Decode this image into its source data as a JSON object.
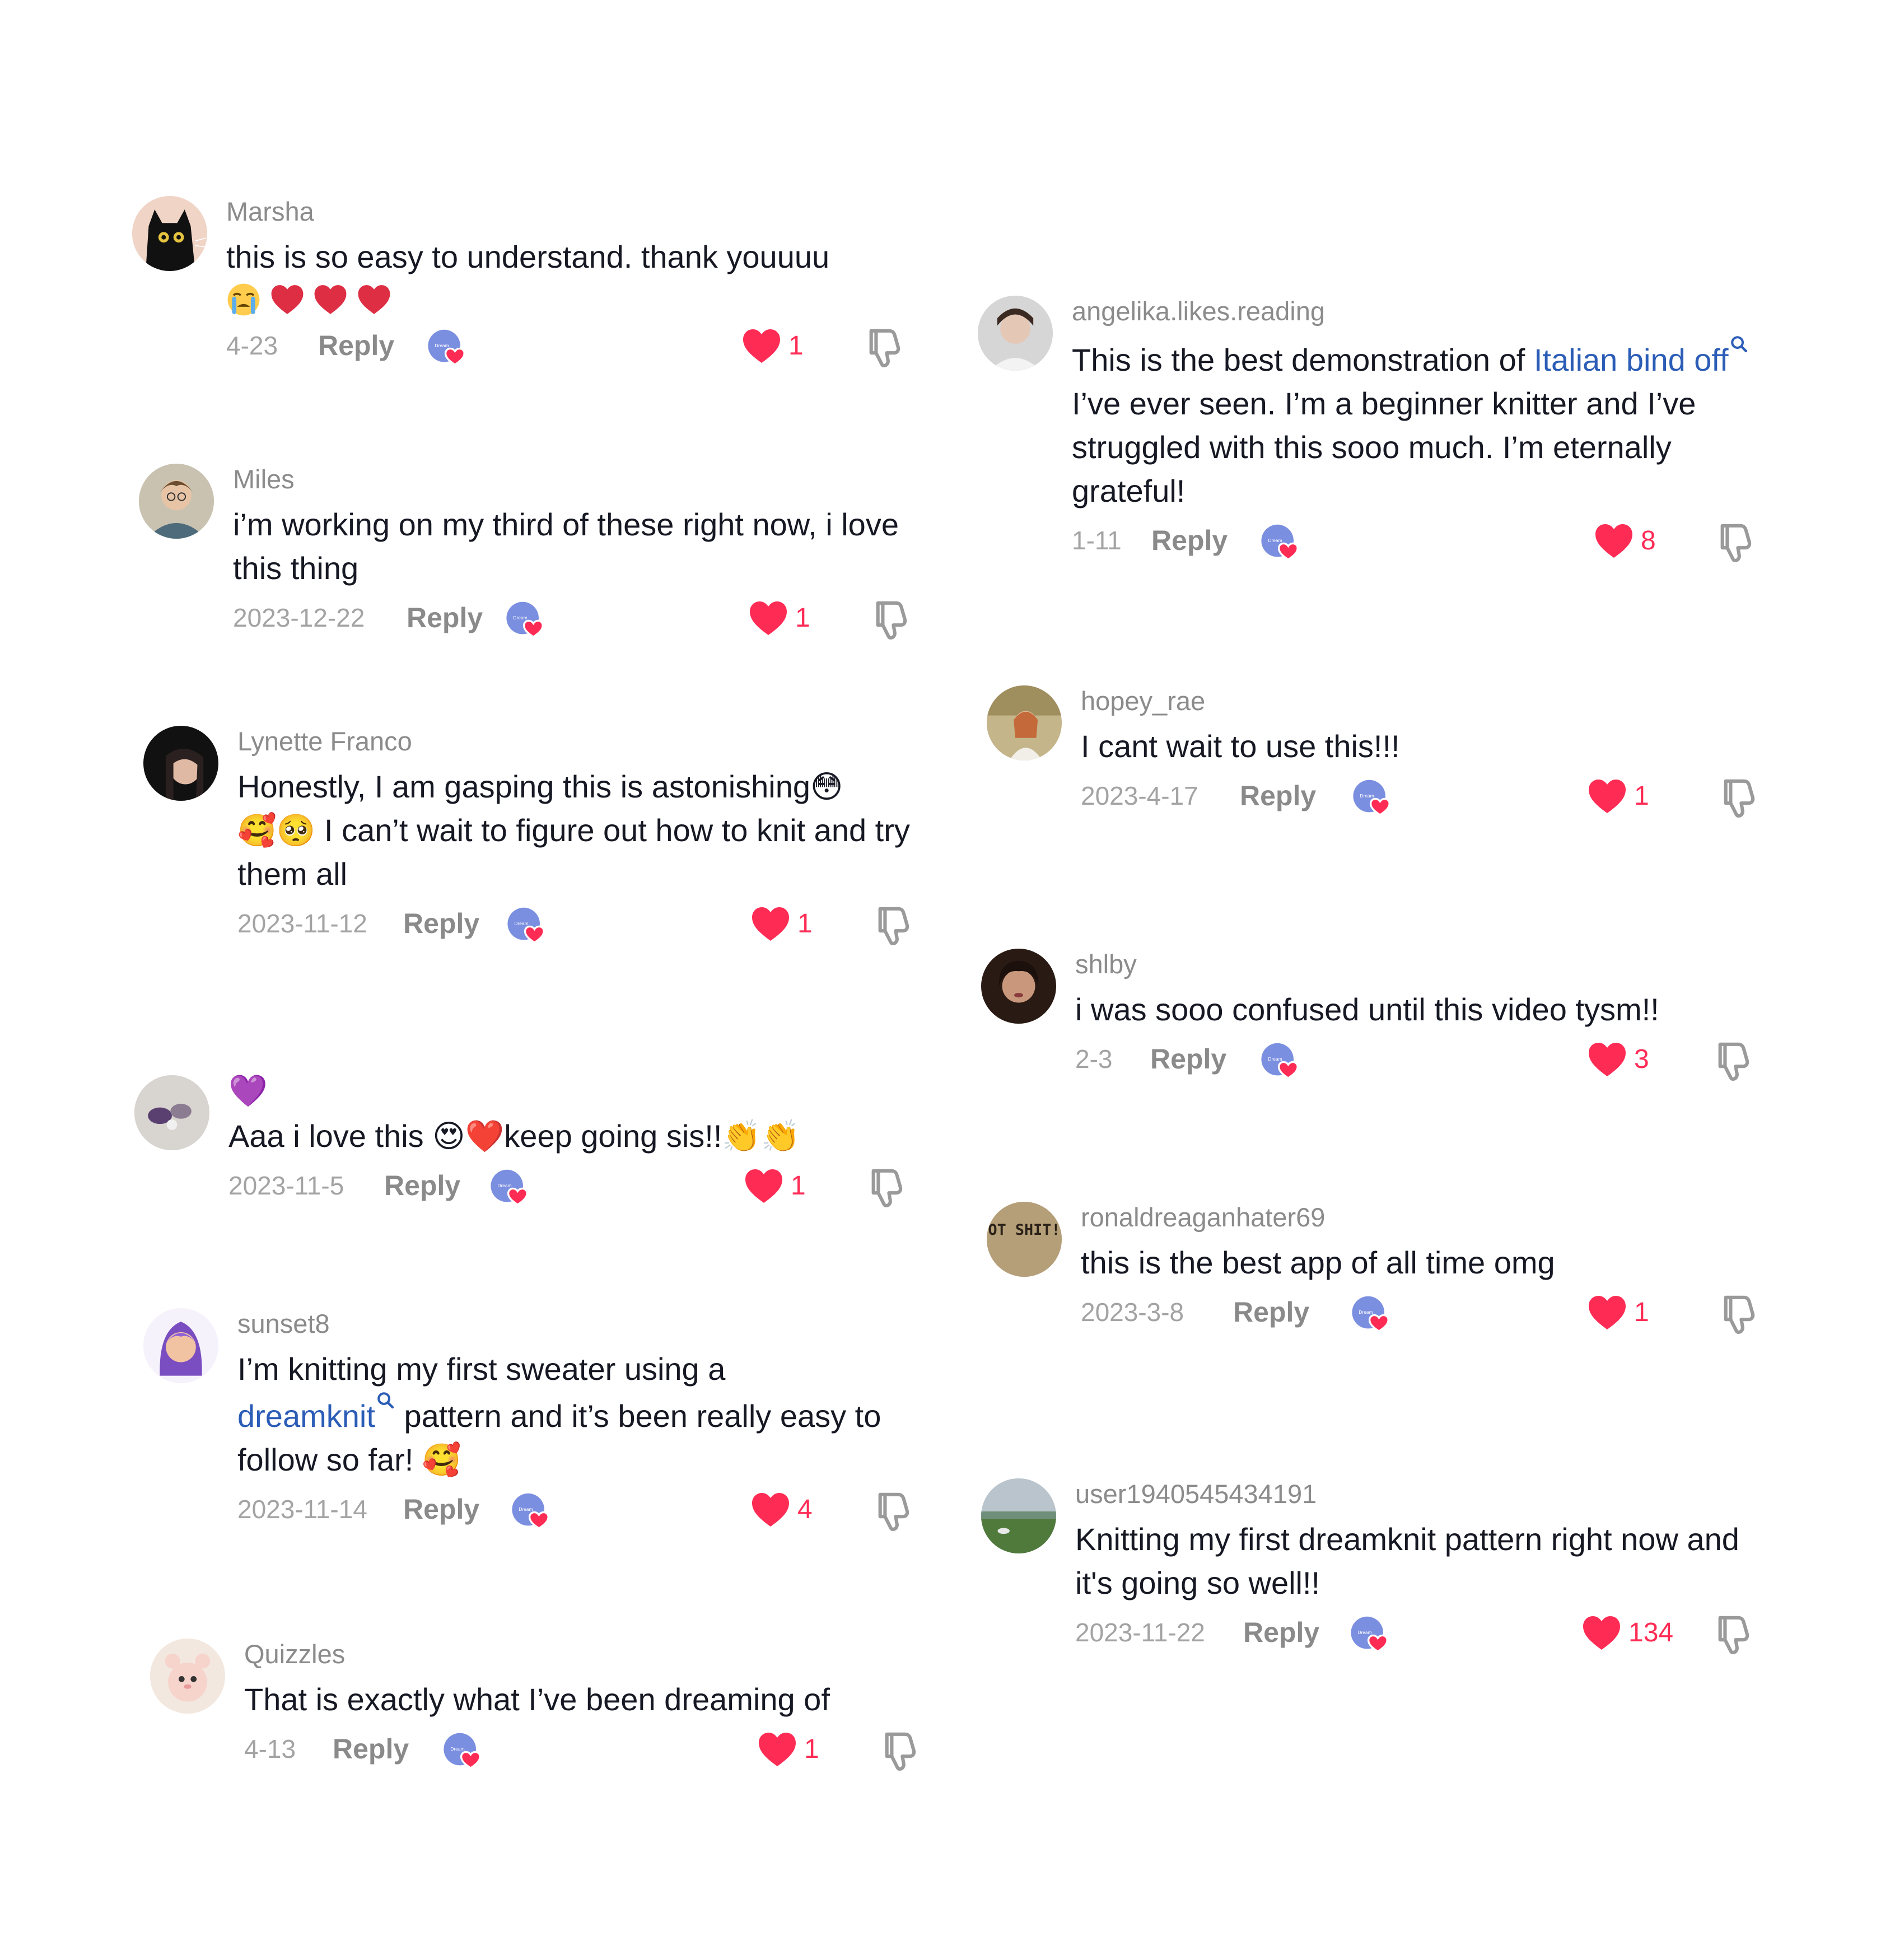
{
  "ui": {
    "reply_label": "Reply"
  },
  "colors": {
    "like": "#fe2c55",
    "link": "#2b5db7",
    "username": "#8b8b8b",
    "meta": "#a3a3a3"
  },
  "left_column": [
    {
      "username": "Marsha",
      "text": "this is so easy to understand. thank youuuu",
      "emoji_line": "😭❤️❤️❤️",
      "date": "4-23",
      "likes": "1"
    },
    {
      "username": "Miles",
      "text": "i’m working on my third of these right now, i love this thing",
      "date": "2023-12-22",
      "likes": "1"
    },
    {
      "username": "Lynette Franco",
      "text_a": "Honestly, I am gasping this is astonishing😳",
      "text_b": "🥰🥺 I can’t wait to figure out how to knit and try them all",
      "date": "2023-11-12",
      "likes": "1"
    },
    {
      "username": "💜",
      "text": "Aaa i love this 😍❤️keep going sis!!👏👏",
      "date": "2023-11-5",
      "likes": "1"
    },
    {
      "username": "sunset8",
      "text_a": "I’m knitting my first sweater using a",
      "link": "dreamknit",
      "text_b": "pattern and it’s been really easy to follow so far! 🥰",
      "date": "2023-11-14",
      "likes": "4"
    },
    {
      "username": "Quizzles",
      "text": "That is exactly what I’ve been dreaming of",
      "date": "4-13",
      "likes": "1"
    }
  ],
  "right_column": [
    {
      "username": "angelika.likes.reading",
      "text_a": "This is the best demonstration of",
      "link": "Italian bind off",
      "text_b": "I’ve ever seen. I’m a beginner knitter and I’ve struggled with this sooo much. I’m eternally grateful!",
      "date": "1-11",
      "likes": "8"
    },
    {
      "username": "hopey_rae",
      "text": "I cant wait to use this!!!",
      "date": "2023-4-17",
      "likes": "1"
    },
    {
      "username": "shlby",
      "text": "i was sooo confused until this video tysm!!",
      "date": "2-3",
      "likes": "3"
    },
    {
      "username": "ronaldreaganhater69",
      "text": "this is the best app of all time omg",
      "date": "2023-3-8",
      "likes": "1",
      "avatar_text": "HOT SHIT!!"
    },
    {
      "username": "user1940545434191",
      "text": "Knitting my first dreamknit pattern right now and it's going so well!!",
      "date": "2023-11-22",
      "likes": "134"
    }
  ]
}
